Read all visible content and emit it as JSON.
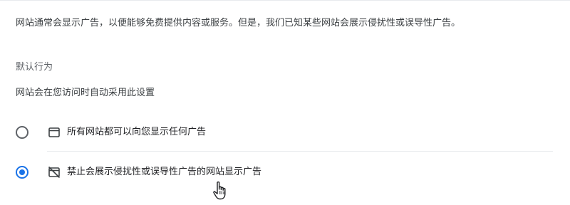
{
  "description": "网站通常会显示广告，以便能够免费提供内容或服务。但是，我们已知某些网站会展示侵扰性或误导性广告。",
  "default_behavior": {
    "heading": "默认行为",
    "subheading": "网站会在您访问时自动采用此设置"
  },
  "options": [
    {
      "label": "所有网站都可以向您显示任何广告",
      "icon": "browser-window-icon",
      "selected": false
    },
    {
      "label": "禁止会展示侵扰性或误导性广告的网站显示广告",
      "icon": "ads-blocked-icon",
      "selected": true
    }
  ],
  "colors": {
    "accent": "#1a73e8",
    "text_primary": "#202124",
    "text_secondary": "#5f6368"
  }
}
